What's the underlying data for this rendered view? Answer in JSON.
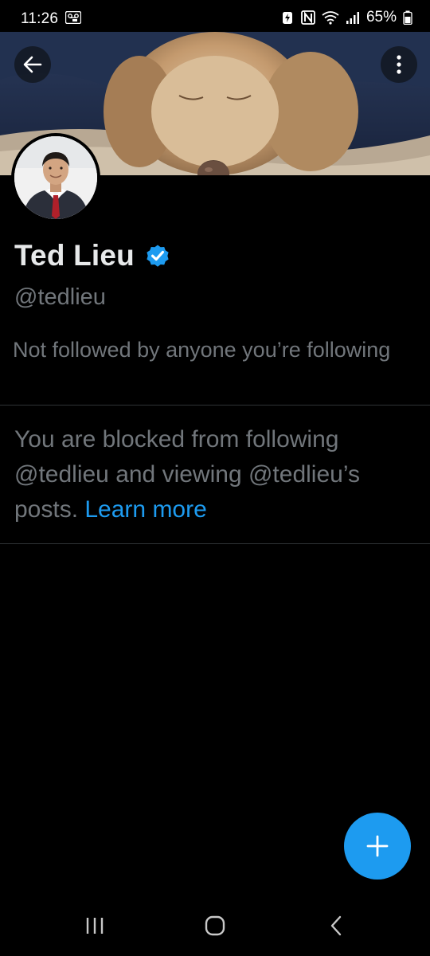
{
  "status_bar": {
    "time": "11:26",
    "battery_percent": "65%",
    "icons": [
      "voicemail-icon",
      "battery-saver-icon",
      "nfc-icon",
      "wifi-icon",
      "signal-icon",
      "battery-icon"
    ]
  },
  "header": {
    "back_icon": "arrow-left-icon",
    "more_icon": "more-vertical-icon"
  },
  "profile": {
    "display_name": "Ted Lieu",
    "verified": true,
    "verified_color": "#1d9bf0",
    "handle": "@tedlieu",
    "followed_by_text": "Not followed by anyone you’re following"
  },
  "blocked_notice": {
    "text": "You are blocked from following @tedlieu and viewing @tedlieu’s posts. ",
    "link_label": "Learn more"
  },
  "fab": {
    "icon": "plus-icon"
  },
  "system_nav": {
    "buttons": [
      "recents-icon",
      "home-icon",
      "back-chevron-icon"
    ]
  },
  "colors": {
    "background": "#000000",
    "primary_text": "#e7e9ea",
    "secondary_text": "#71767b",
    "accent": "#1d9bf0",
    "divider": "#2f3336"
  }
}
